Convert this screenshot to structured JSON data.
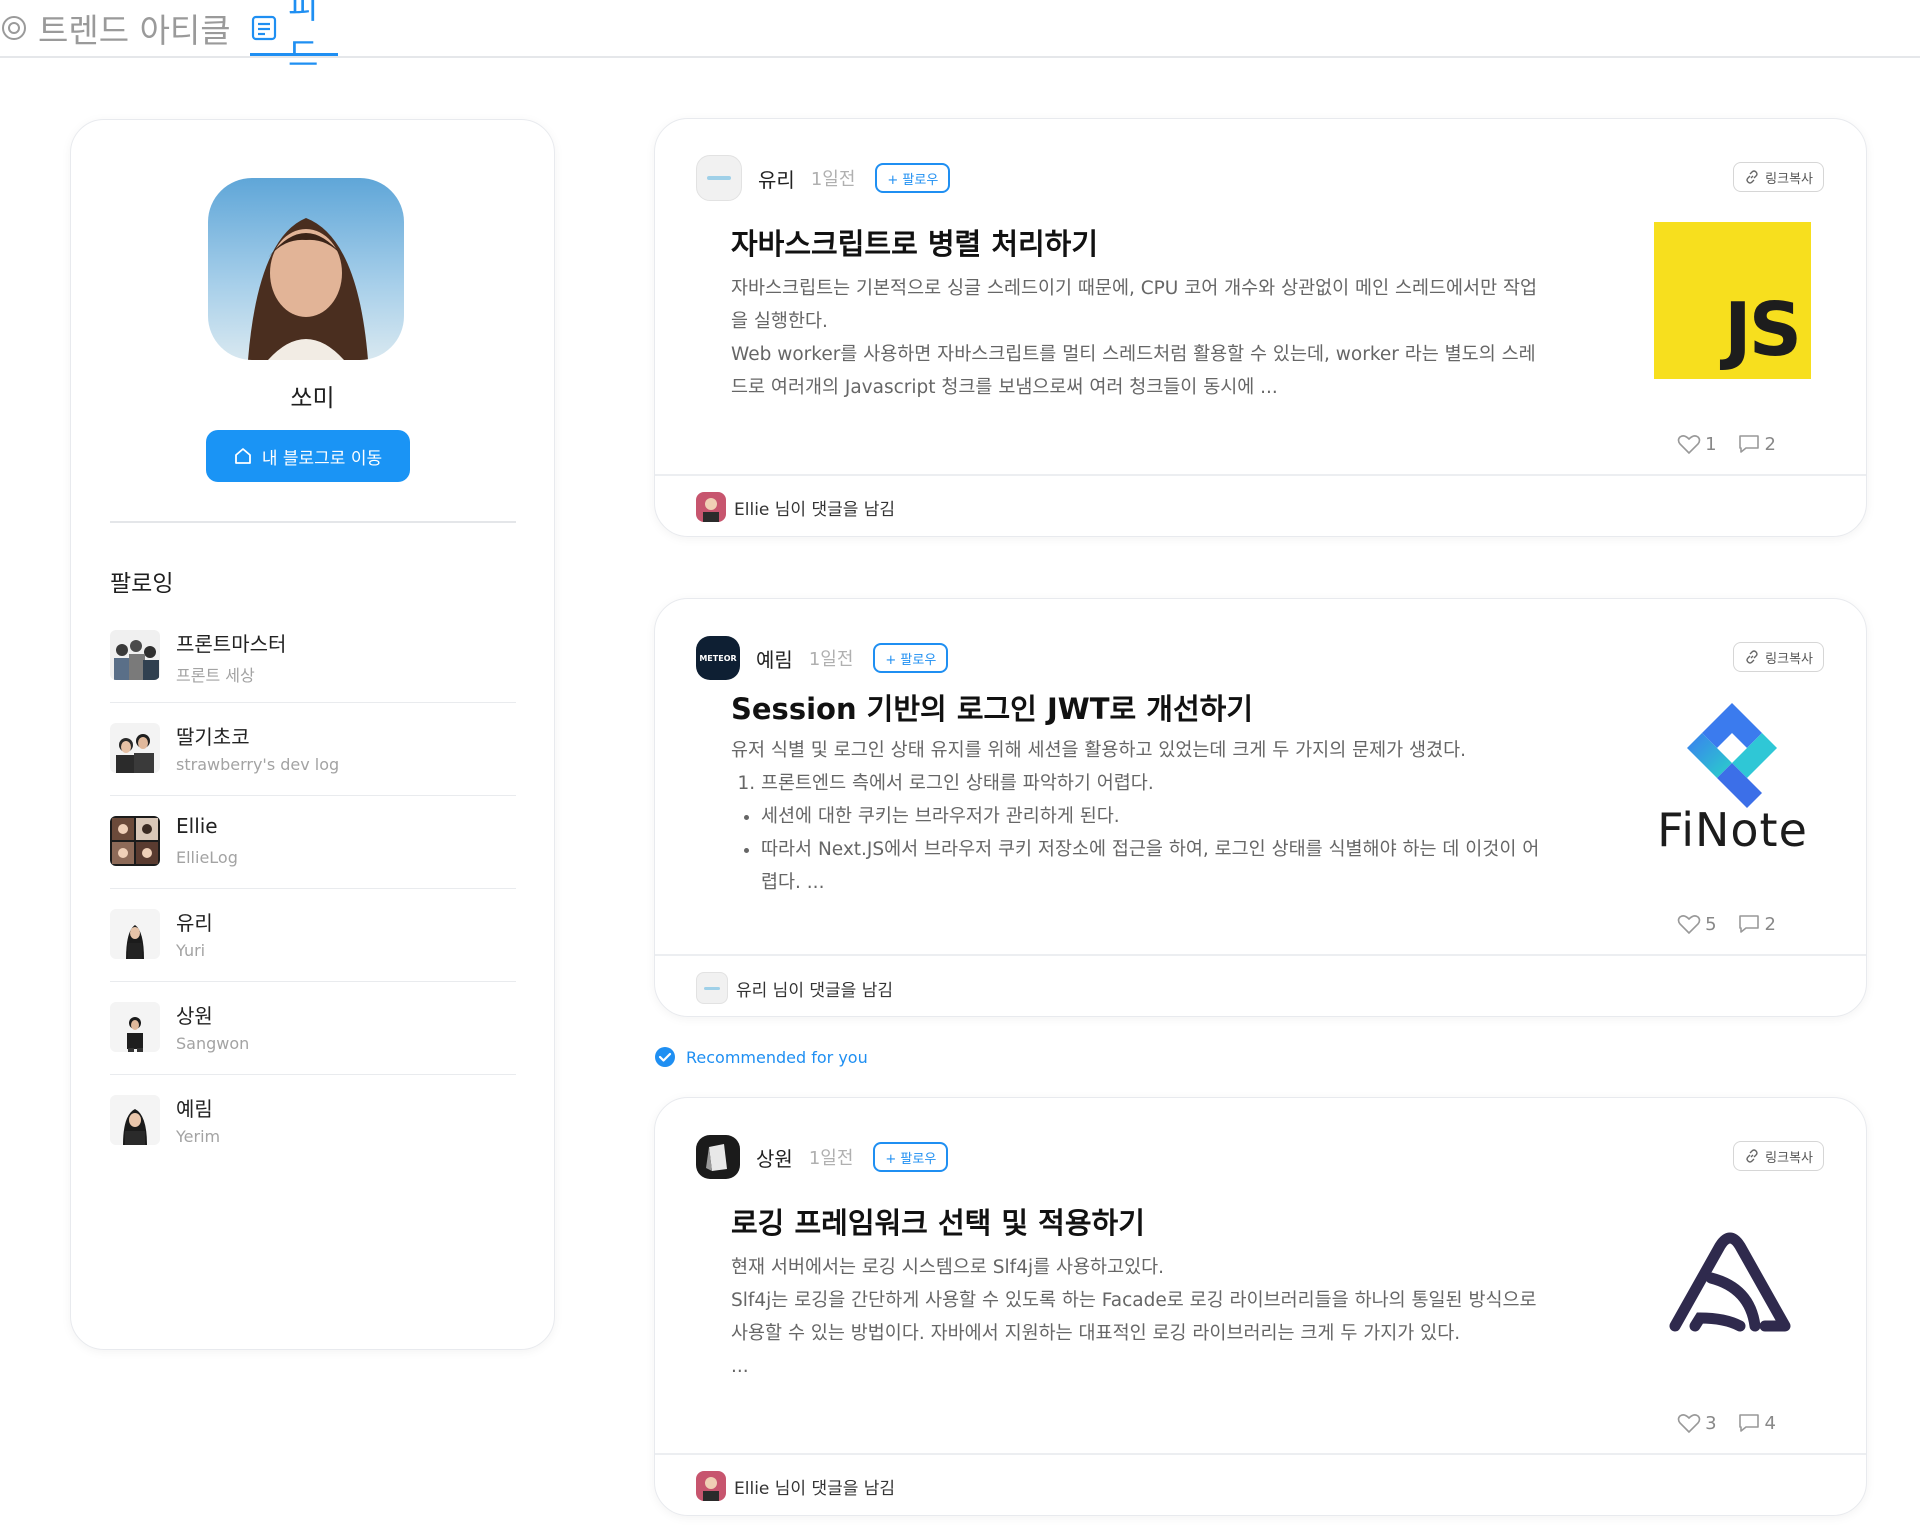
{
  "tabs": [
    {
      "label": "트렌드 아티클",
      "icon": "target-icon",
      "active": false
    },
    {
      "label": "피드",
      "icon": "feed-icon",
      "active": true
    }
  ],
  "profile": {
    "name": "쏘미",
    "blog_button": "내 블로그로 이동",
    "following_title": "팔로잉",
    "following": [
      {
        "name": "프론트마스터",
        "sub": "프론트 세상"
      },
      {
        "name": "딸기초코",
        "sub": "strawberry's dev log"
      },
      {
        "name": "Ellie",
        "sub": "EllieLog"
      },
      {
        "name": "유리",
        "sub": "Yuri"
      },
      {
        "name": "상원",
        "sub": "Sangwon"
      },
      {
        "name": "예림",
        "sub": "Yerim"
      }
    ]
  },
  "posts": [
    {
      "author": "유리",
      "time": "1일전",
      "follow": "+ 팔로우",
      "link_copy": "링크복사",
      "title": "자바스크립트로 병렬 처리하기",
      "body": [
        "자바스크립트는 기본적으로 싱글 스레드이기 때문에, CPU 코어 개수와 상관없이 메인 스레드에서만 작업을 실행한다.",
        "Web worker를 사용하면 자바스크립트를 멀티 스레드처럼 활용할 수 있는데, worker 라는 별도의 스레드로 여러개의 Javascript 청크를 보냄으로써 여러 청크들이 동시에 ..."
      ],
      "thumb_text": "JS",
      "likes": "1",
      "comments": "2",
      "footer": "Ellie 님이 댓글을 남김"
    },
    {
      "author": "예림",
      "time": "1일전",
      "follow": "+ 팔로우",
      "link_copy": "링크복사",
      "avatar_text": "METEOR",
      "title": "Session 기반의 로그인 JWT로 개선하기",
      "intro": "유저 식별 및 로그인 상태 유지를 위해 세션을 활용하고 있었는데 크게 두 가지의 문제가 생겼다.",
      "ordered": [
        "프론트엔드 측에서 로그인 상태를 파악하기 어렵다."
      ],
      "bullets": [
        "세션에 대한 쿠키는 브라우저가 관리하게 된다.",
        "따라서 Next.JS에서 브라우저 쿠키 저장소에 접근을 하여, 로그인 상태를 식별해야 하는 데 이것이 어렵다. ..."
      ],
      "thumb_text": "FiNote",
      "likes": "5",
      "comments": "2",
      "footer": "유리 님이 댓글을 남김"
    },
    {
      "author": "상원",
      "time": "1일전",
      "follow": "+ 팔로우",
      "link_copy": "링크복사",
      "title": "로깅 프레임워크 선택 및 적용하기",
      "body": [
        "현재 서버에서는 로깅 시스템으로 Slf4j를 사용하고있다.",
        "Slf4j는 로깅을 간단하게 사용할 수 있도록 하는 Facade로 로깅 라이브러리들을 하나의 통일된 방식으로 사용할 수 있는 방법이다. 자바에서 지원하는 대표적인 로깅 라이브러리는 크게 두 가지가 있다.",
        "..."
      ],
      "likes": "3",
      "comments": "4",
      "footer": "Ellie 님이 댓글을 남김"
    }
  ],
  "recommended": "Recommended for you",
  "colors": {
    "accent": "#1f8ff2",
    "button": "#1a94f5",
    "js_yellow": "#f7df1e",
    "sentry_navy": "#2f2a4d"
  }
}
